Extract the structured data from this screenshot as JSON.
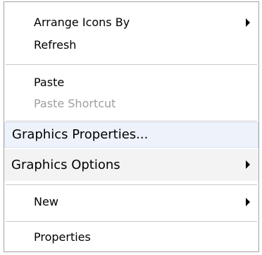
{
  "menu": {
    "items": [
      {
        "label": "Arrange Icons By",
        "submenu": true
      },
      {
        "label": "Refresh"
      },
      {
        "label": "Paste"
      },
      {
        "label": "Paste Shortcut",
        "disabled": true
      },
      {
        "label": "Graphics Properties...",
        "highlighted": true
      },
      {
        "label": "Graphics Options",
        "submenu": true
      },
      {
        "label": "New",
        "submenu": true
      },
      {
        "label": "Properties"
      }
    ]
  }
}
